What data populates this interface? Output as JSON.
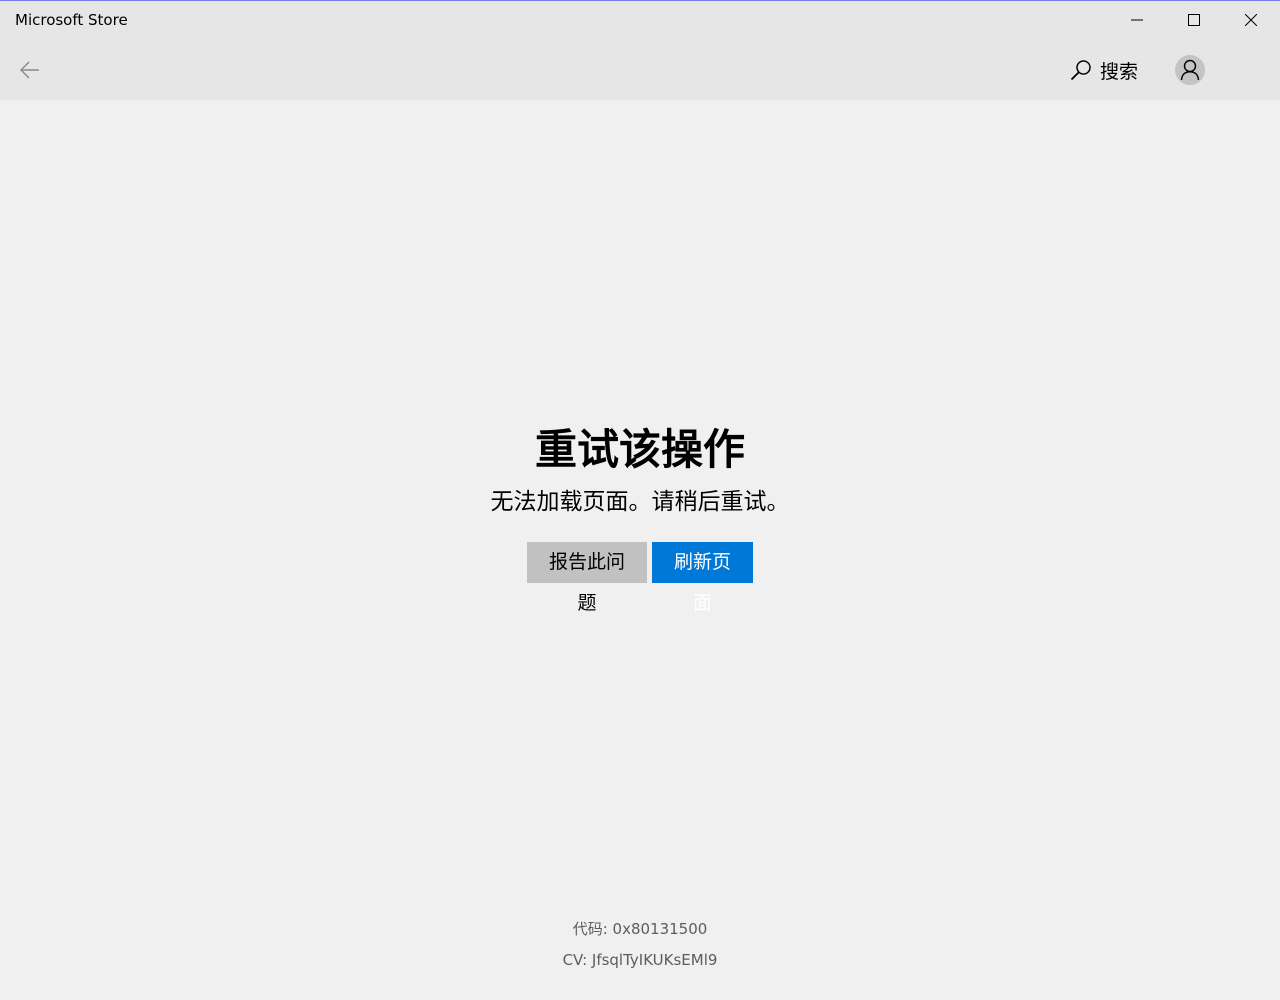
{
  "window": {
    "title": "Microsoft Store"
  },
  "header": {
    "search_label": "搜索"
  },
  "error": {
    "title": "重试该操作",
    "message": "无法加载页面。请稍后重试。",
    "report_label": "报告此问题",
    "refresh_label": "刷新页面"
  },
  "footer": {
    "code": "代码: 0x80131500",
    "cv": "CV: JfsqlTyIKUKsEMl9"
  },
  "icons": {
    "back": "back-arrow-icon",
    "search": "search-icon",
    "avatar": "user-icon",
    "minimize": "minimize-icon",
    "maximize": "maximize-icon",
    "close": "close-icon"
  },
  "colors": {
    "accent": "#0078d7",
    "secondary_button": "#c1c1c1",
    "background": "#f0f0f0",
    "titlebar": "#e6e6e6"
  }
}
